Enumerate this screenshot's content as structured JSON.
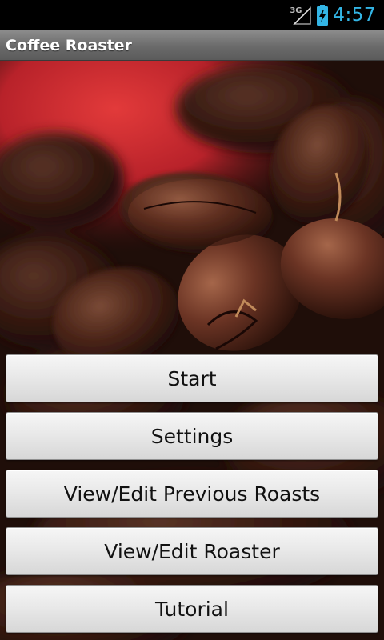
{
  "status_bar": {
    "network_type": "3G",
    "time": "4:57",
    "icons": [
      "signal-icon",
      "battery-charging-icon"
    ],
    "clock_color": "#33b5e5"
  },
  "title_bar": {
    "title": "Coffee Roaster"
  },
  "background": {
    "image": "coffee-beans-photo"
  },
  "menu": {
    "start_label": "Start",
    "settings_label": "Settings",
    "previous_roasts_label": "View/Edit Previous Roasts",
    "roaster_label": "View/Edit Roaster",
    "tutorial_label": "Tutorial"
  }
}
